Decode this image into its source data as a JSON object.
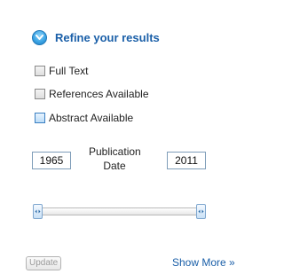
{
  "refine": {
    "title": "Refine your results",
    "icon": "chevron-down-circle-icon",
    "accent_color": "#1a5fa8"
  },
  "filters": [
    {
      "label": "Full Text",
      "checked": false,
      "highlighted": false
    },
    {
      "label": "References Available",
      "checked": false,
      "highlighted": false
    },
    {
      "label": "Abstract Available",
      "checked": false,
      "highlighted": true
    }
  ],
  "date_range": {
    "from": "1965",
    "to": "2011",
    "label_line1": "Publication",
    "label_line2": "Date"
  },
  "slider": {
    "min_fraction": 0,
    "max_fraction": 1
  },
  "actions": {
    "update_label": "Update",
    "show_more_label": "Show More »"
  }
}
